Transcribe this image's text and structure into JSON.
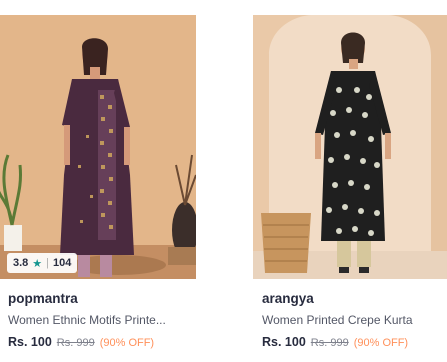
{
  "products": [
    {
      "brand": "popmantra",
      "title": "Women Ethnic Motifs Printe...",
      "price": "Rs. 100",
      "mrp": "Rs. 999",
      "discount": "(90% OFF)",
      "rating": {
        "value": "3.8",
        "star_icon": "star-icon",
        "count": "104"
      },
      "image": {
        "background": "#e6b98f",
        "garment": "#4a2a3f",
        "accent": "#c9a15d"
      }
    },
    {
      "brand": "arangya",
      "title": "Women Printed Crepe Kurta",
      "price": "Rs. 100",
      "mrp": "Rs. 999",
      "discount": "(90% OFF)",
      "image": {
        "background": "#f2dcc6",
        "garment": "#1f1f1f",
        "accent": "#d8d8c8"
      }
    }
  ],
  "theme": {
    "text_primary": "#282c3f",
    "text_secondary": "#535766",
    "discount": "#ff905a",
    "star": "#14958f"
  }
}
